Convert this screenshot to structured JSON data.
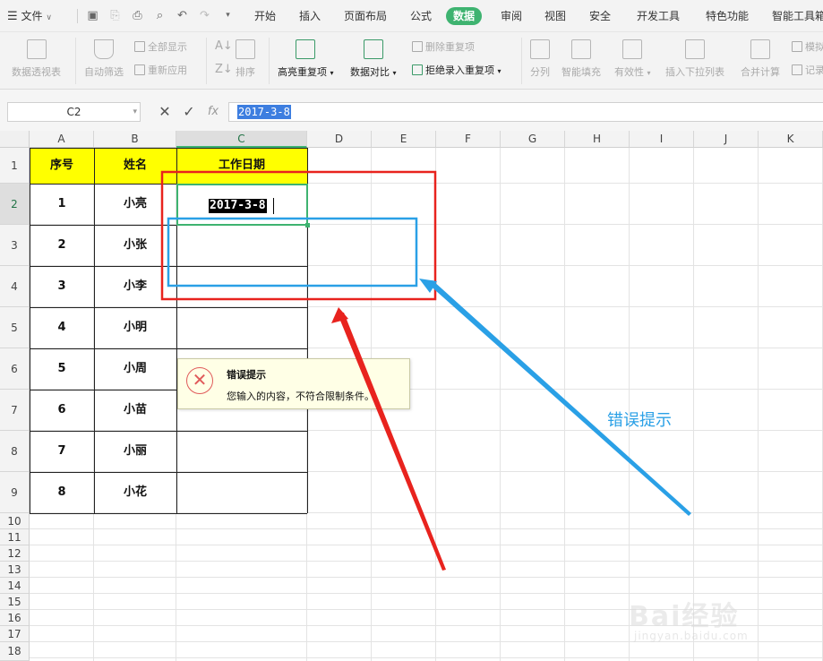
{
  "menubar": {
    "file": "文件",
    "tabs": [
      "开始",
      "插入",
      "页面布局",
      "公式",
      "数据",
      "审阅",
      "视图",
      "安全",
      "开发工具",
      "特色功能",
      "智能工具箱"
    ],
    "active_tab": "数据"
  },
  "ribbon": {
    "pivot": "数据透视表",
    "autofilter": "自动筛选",
    "show_all": "全部显示",
    "reapply": "重新应用",
    "sort": "排序",
    "highlight_dup": "高亮重复项",
    "compare": "数据对比",
    "remove_dup": "删除重复项",
    "reject_dup": "拒绝录入重复项",
    "split": "分列",
    "smart_fill": "智能填充",
    "validity": "有效性",
    "insert_dropdown": "插入下拉列表",
    "consolidate": "合并计算",
    "simulate": "模拟分析",
    "record": "记录单"
  },
  "formulabar": {
    "cell_ref": "C2",
    "fx": "fx",
    "value": "2017-3-8"
  },
  "grid": {
    "columns": [
      "A",
      "B",
      "C",
      "D",
      "E",
      "F",
      "G",
      "H",
      "I",
      "J",
      "K"
    ],
    "rows": [
      "1",
      "2",
      "3",
      "4",
      "5",
      "6",
      "7",
      "8",
      "9",
      "10",
      "11",
      "12",
      "13",
      "14",
      "15",
      "16",
      "17",
      "18"
    ],
    "headers": [
      "序号",
      "姓名",
      "工作日期"
    ],
    "data": [
      [
        "1",
        "小亮"
      ],
      [
        "2",
        "小张"
      ],
      [
        "3",
        "小李"
      ],
      [
        "4",
        "小明"
      ],
      [
        "5",
        "小周"
      ],
      [
        "6",
        "小苗"
      ],
      [
        "7",
        "小丽"
      ],
      [
        "8",
        "小花"
      ]
    ],
    "editing_value": "2017-3-8"
  },
  "error_tip": {
    "title": "错误提示",
    "message": "您输入的内容，不符合限制条件。"
  },
  "annotation": {
    "label": "错误提示",
    "red_color": "#e8231e",
    "blue_color": "#2aa0e6"
  },
  "watermark": {
    "text": "Bai经验",
    "sub": "jingyan.baidu.com"
  }
}
